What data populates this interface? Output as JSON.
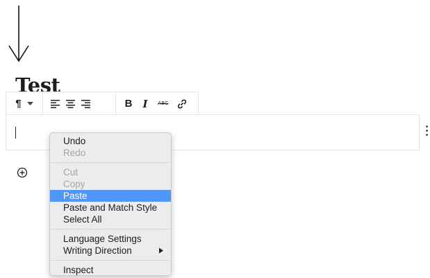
{
  "post": {
    "title": "Test"
  },
  "toolbar": {
    "paragraph_icon": "¶",
    "bold_label": "B",
    "italic_label": "I",
    "strikethrough_label": "ABC"
  },
  "context_menu": {
    "undo": "Undo",
    "redo": "Redo",
    "cut": "Cut",
    "copy": "Copy",
    "paste": "Paste",
    "paste_match": "Paste and Match Style",
    "select_all": "Select All",
    "language": "Language Settings",
    "writing_direction": "Writing Direction",
    "inspect": "Inspect"
  },
  "icons": [
    "down-arrow-icon",
    "paragraph-icon",
    "chevron-down-icon",
    "align-left-icon",
    "align-center-icon",
    "align-right-icon",
    "link-icon",
    "more-vertical-icon",
    "plus-circle-icon",
    "submenu-arrow-icon"
  ],
  "colors": {
    "highlight": "#4f96f5",
    "menu_bg": "#ececec",
    "border": "#e2e4e7"
  }
}
